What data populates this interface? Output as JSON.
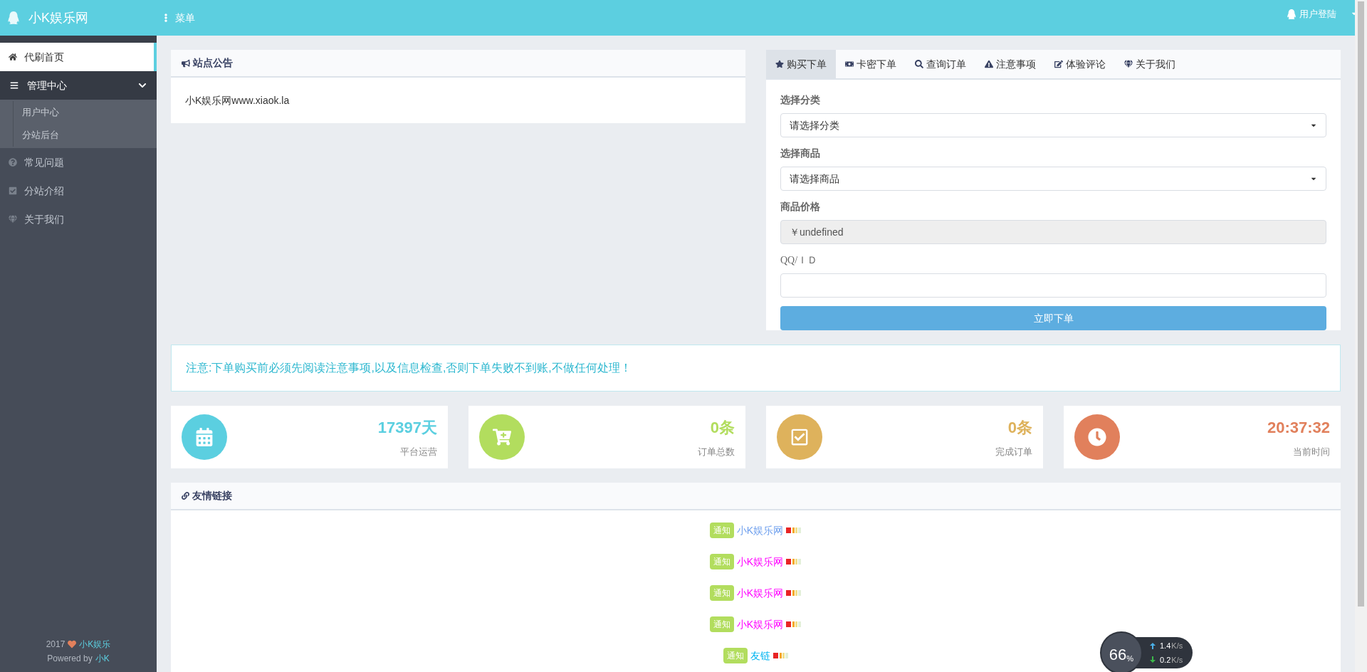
{
  "topbar": {
    "brand": "小K娱乐网",
    "menu": "菜单",
    "login": "用户登陆"
  },
  "sidebar": {
    "items": [
      {
        "label": "代刷首页",
        "selected": true
      },
      {
        "label": "管理中心",
        "selected": false,
        "expanded": true,
        "children": [
          {
            "label": "用户中心"
          },
          {
            "label": "分站后台"
          }
        ]
      },
      {
        "label": "常见问题",
        "selected": false
      },
      {
        "label": "分站介绍",
        "selected": false
      },
      {
        "label": "关于我们",
        "selected": false
      }
    ],
    "footer": {
      "year": "2017",
      "brand": "小K娱乐",
      "powered": "Powered by",
      "author": "小K"
    }
  },
  "announcement": {
    "title": "站点公告",
    "text": "小K娱乐网www.xiaok.la"
  },
  "order": {
    "tabs": [
      {
        "label": "购买下单",
        "selected": true
      },
      {
        "label": "卡密下单",
        "selected": false
      },
      {
        "label": "查询订单",
        "selected": false
      },
      {
        "label": "注意事项",
        "selected": false
      },
      {
        "label": "体验评论",
        "selected": false
      },
      {
        "label": "关于我们",
        "selected": false
      }
    ],
    "fields": [
      {
        "kind": "select",
        "label": "选择分类",
        "value": "请选择分类"
      },
      {
        "kind": "select",
        "label": "选择商品",
        "value": "请选择商品"
      },
      {
        "kind": "readonly",
        "label": "商品价格",
        "value": "￥undefined"
      },
      {
        "kind": "input",
        "label": "QQ/ＩＤ"
      }
    ],
    "submit": "立即下单"
  },
  "notice": "注意:下单购买前必须先阅读注意事项,以及信息检查,否则下单失败不到账,不做任何处理！",
  "stats": [
    {
      "value": "17397天",
      "label": "平台运营",
      "color": "#5bcfe0"
    },
    {
      "value": "0条",
      "label": "订单总数",
      "color": "#b2dd5e"
    },
    {
      "value": "0条",
      "label": "完成订单",
      "color": "#deb25c"
    },
    {
      "value": "20:37:32",
      "label": "当前时间",
      "color": "#e1805c"
    }
  ],
  "links": {
    "title": "友情链接",
    "items": [
      {
        "badge": "通知",
        "text": "小K娱乐网",
        "color": "#6fa0ee"
      },
      {
        "badge": "通知",
        "text": "小K娱乐网",
        "color": "#ff00ff"
      },
      {
        "badge": "通知",
        "text": "小K娱乐网",
        "color": "#ff00ff"
      },
      {
        "badge": "通知",
        "text": "小K娱乐网",
        "color": "#ff00ff"
      },
      {
        "badge": "通知",
        "text": "友链",
        "color": "#00b4f0"
      }
    ]
  },
  "speed_widget": {
    "percent": "66",
    "percent_unit": "%",
    "up": "1.4",
    "up_unit": "K/s",
    "down": "0.2",
    "down_unit": "K/s"
  }
}
